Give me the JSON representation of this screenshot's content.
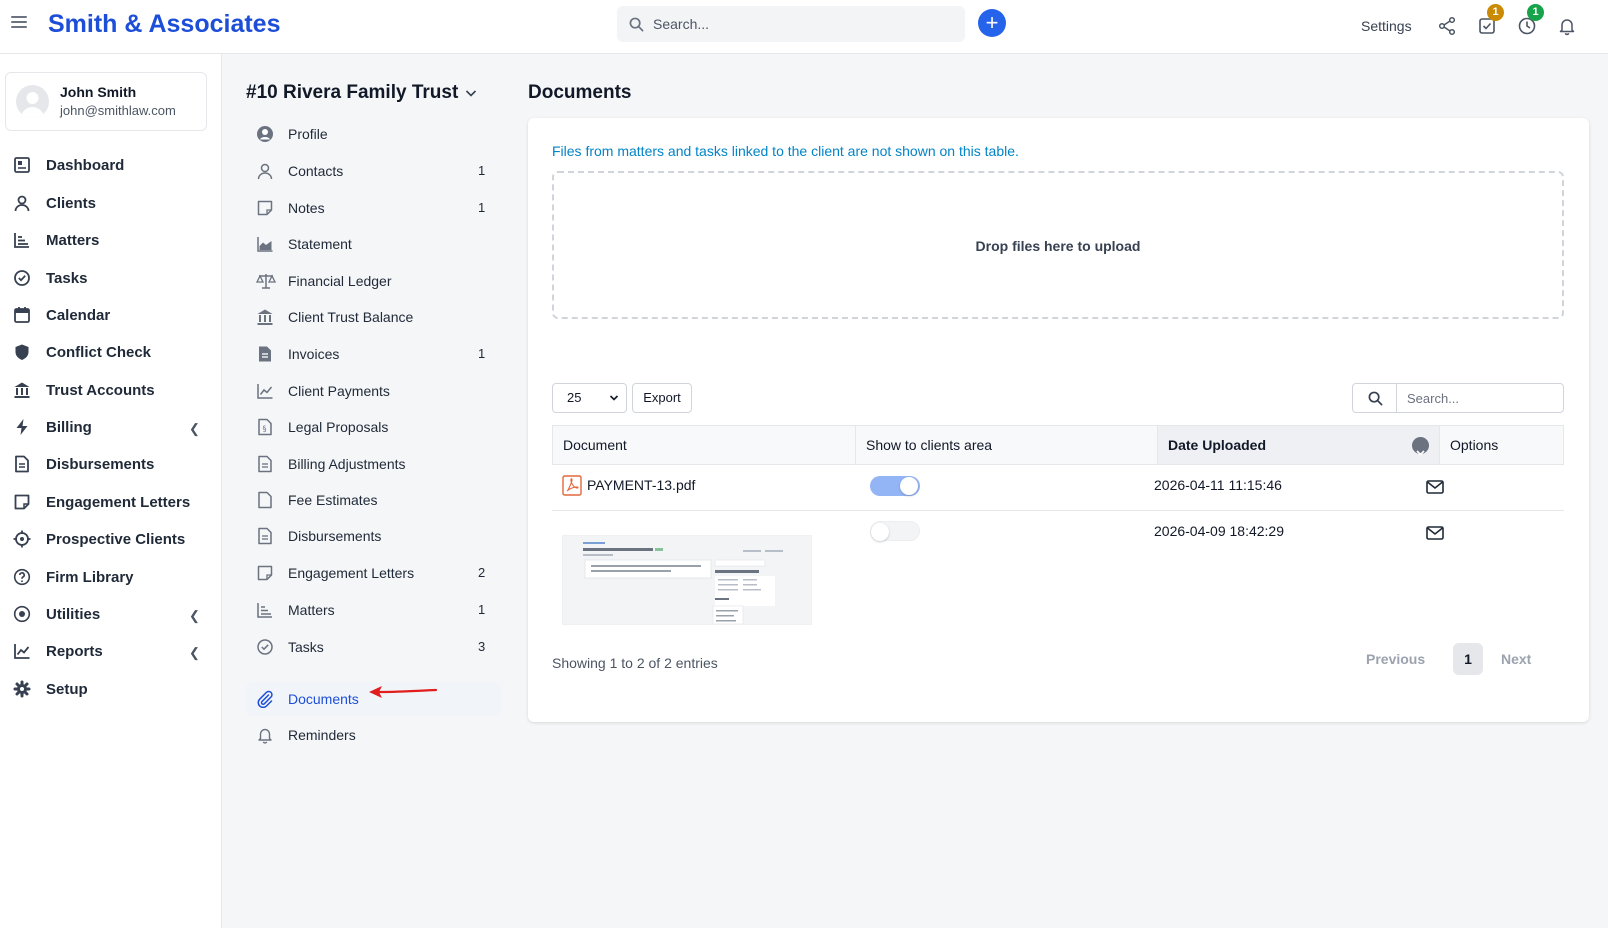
{
  "header": {
    "brand": "Smith & Associates",
    "search_placeholder": "Search...",
    "settings_label": "Settings",
    "tasks_badge": "1",
    "timer_badge": "1",
    "colors": {
      "brand": "#1d4ed8",
      "accent": "#2563eb",
      "tasks_badge": "#ca8a04",
      "timer_badge": "#16a34a"
    }
  },
  "user": {
    "name": "John Smith",
    "email": "john@smithlaw.com"
  },
  "nav": {
    "items": [
      {
        "label": "Dashboard",
        "icon": "dashboard-icon"
      },
      {
        "label": "Clients",
        "icon": "user-icon"
      },
      {
        "label": "Matters",
        "icon": "matters-icon"
      },
      {
        "label": "Tasks",
        "icon": "check-circle-icon"
      },
      {
        "label": "Calendar",
        "icon": "calendar-icon"
      },
      {
        "label": "Conflict Check",
        "icon": "shield-icon"
      },
      {
        "label": "Trust Accounts",
        "icon": "bank-icon"
      },
      {
        "label": "Billing",
        "icon": "bolt-icon"
      },
      {
        "label": "Disbursements",
        "icon": "file-icon"
      },
      {
        "label": "Engagement Letters",
        "icon": "letter-icon"
      },
      {
        "label": "Prospective Clients",
        "icon": "crosshair-icon"
      },
      {
        "label": "Firm Library",
        "icon": "question-icon"
      },
      {
        "label": "Utilities",
        "icon": "target-icon"
      },
      {
        "label": "Reports",
        "icon": "chart-icon"
      },
      {
        "label": "Setup",
        "icon": "gear-icon"
      }
    ]
  },
  "client": {
    "title": "#10 Rivera Family Trust",
    "menu": [
      {
        "label": "Profile",
        "count": ""
      },
      {
        "label": "Contacts",
        "count": "1"
      },
      {
        "label": "Notes",
        "count": "1"
      },
      {
        "label": "Statement",
        "count": ""
      },
      {
        "label": "Financial Ledger",
        "count": ""
      },
      {
        "label": "Client Trust Balance",
        "count": ""
      },
      {
        "label": "Invoices",
        "count": "1"
      },
      {
        "label": "Client Payments",
        "count": ""
      },
      {
        "label": "Legal Proposals",
        "count": ""
      },
      {
        "label": "Billing Adjustments",
        "count": ""
      },
      {
        "label": "Fee Estimates",
        "count": ""
      },
      {
        "label": "Disbursements",
        "count": ""
      },
      {
        "label": "Engagement Letters",
        "count": "2"
      },
      {
        "label": "Matters",
        "count": "1"
      },
      {
        "label": "Tasks",
        "count": "3"
      },
      {
        "label": "Documents",
        "count": ""
      },
      {
        "label": "Reminders",
        "count": ""
      }
    ]
  },
  "documents": {
    "title": "Documents",
    "info": "Files from matters and tasks linked to the client are not shown on this table.",
    "dropzone": "Drop files here to upload",
    "page_size": "25",
    "export_label": "Export",
    "search_placeholder": "Search...",
    "columns": {
      "document": "Document",
      "show": "Show to clients area",
      "date": "Date Uploaded",
      "options": "Options"
    },
    "rows": [
      {
        "file": "PAYMENT-13.pdf",
        "show": true,
        "date": "2026-04-11 11:15:46"
      },
      {
        "file": "",
        "show": false,
        "date": "2026-04-09 18:42:29"
      }
    ],
    "entries": "Showing 1 to 2 of 2 entries",
    "prev": "Previous",
    "page": "1",
    "next": "Next"
  }
}
